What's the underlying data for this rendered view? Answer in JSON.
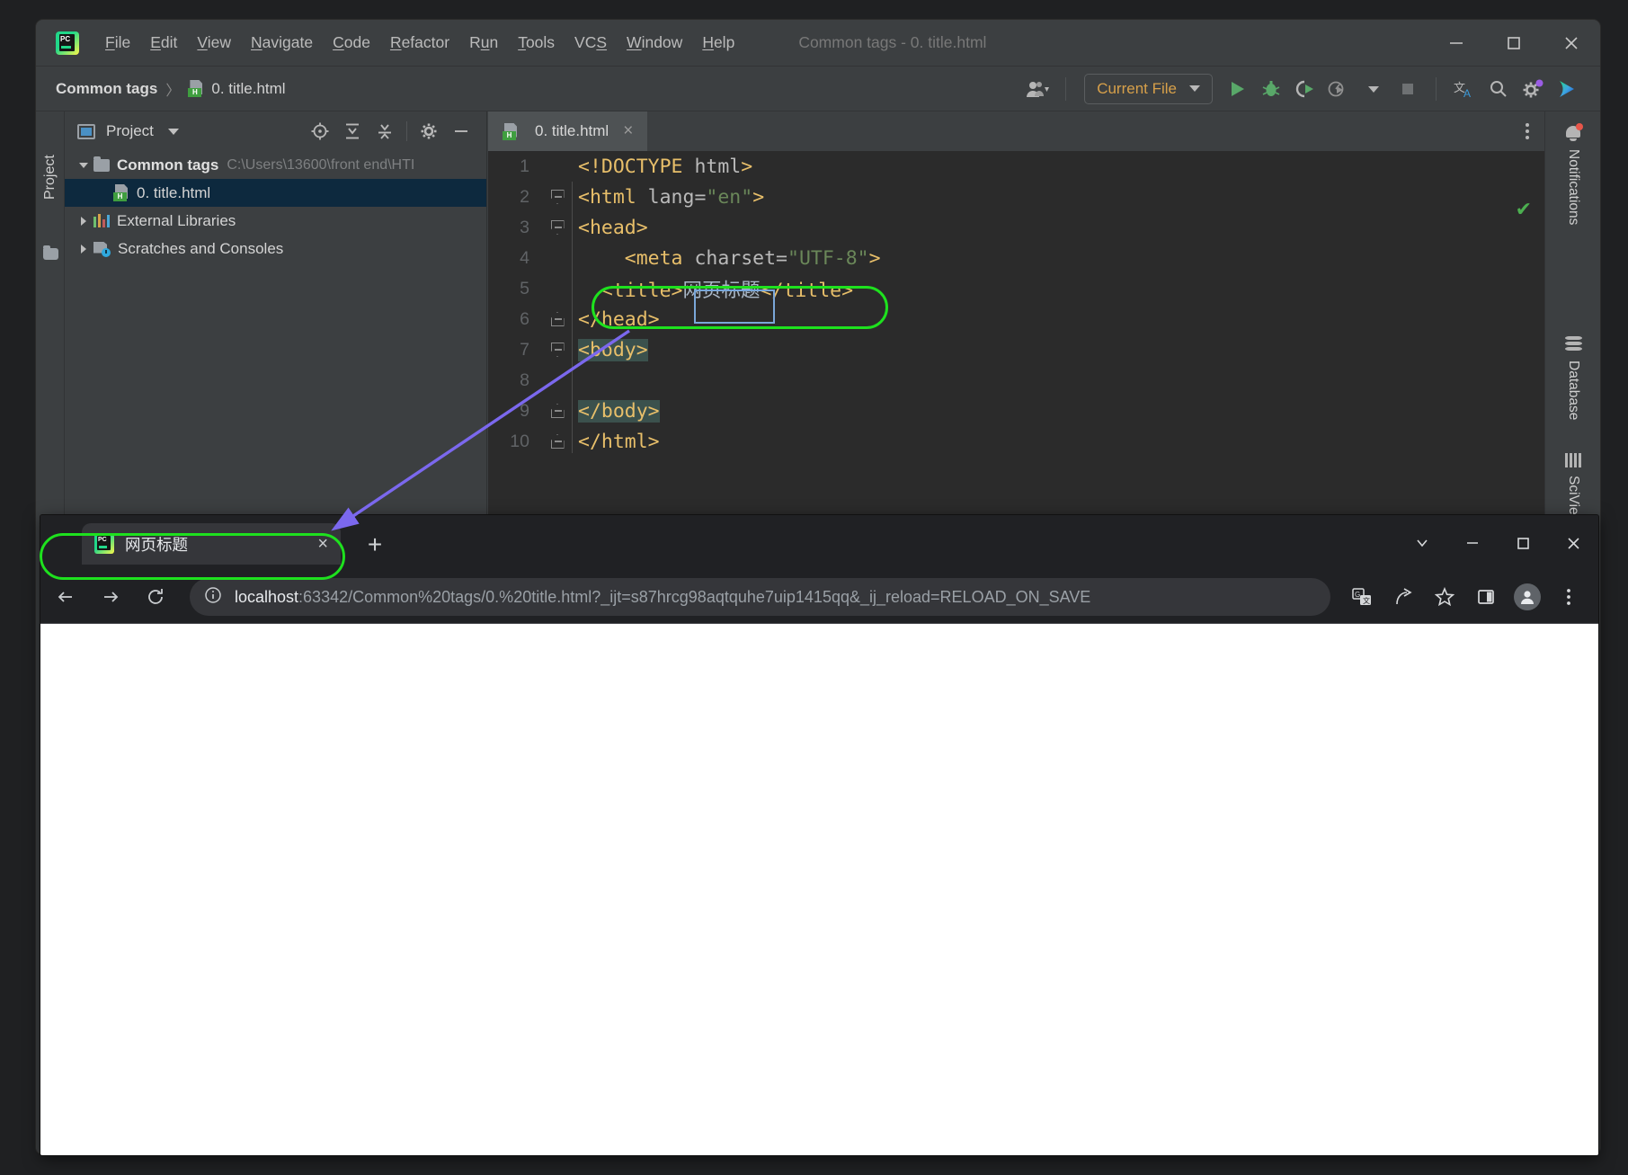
{
  "ide": {
    "logo_icon": "pycharm-logo-icon",
    "menu": [
      {
        "label": "File",
        "mnemonic": "F"
      },
      {
        "label": "Edit",
        "mnemonic": "E"
      },
      {
        "label": "View",
        "mnemonic": "V"
      },
      {
        "label": "Navigate",
        "mnemonic": "N"
      },
      {
        "label": "Code",
        "mnemonic": "C"
      },
      {
        "label": "Refactor",
        "mnemonic": "R"
      },
      {
        "label": "Run",
        "mnemonic": "u"
      },
      {
        "label": "Tools",
        "mnemonic": "T"
      },
      {
        "label": "VCS",
        "mnemonic": "S"
      },
      {
        "label": "Window",
        "mnemonic": "W"
      },
      {
        "label": "Help",
        "mnemonic": "H"
      }
    ],
    "window_title": "Common tags - 0. title.html",
    "window_controls": {
      "minimize": "minimize-icon",
      "maximize": "maximize-icon",
      "close": "close-icon"
    },
    "breadcrumb": {
      "project": "Common tags",
      "separator": "〉",
      "file": "0. title.html"
    },
    "toolbar": {
      "run_config": "Current File",
      "icons": [
        "collaborate-icon",
        "run-icon",
        "debug-icon",
        "run-coverage-icon",
        "profiler-icon",
        "stop-icon",
        "translate-icon",
        "search-everywhere-icon",
        "settings-icon",
        "ide-feature-icon"
      ]
    }
  },
  "project_panel": {
    "title": "Project",
    "tool_icons": [
      "locate-icon",
      "expand-all-icon",
      "collapse-all-icon",
      "settings-icon",
      "hide-icon"
    ],
    "vertical_tab": "Project",
    "tree": [
      {
        "label": "Common tags",
        "path": "C:\\Users\\13600\\front end\\HTI",
        "icon": "folder-icon",
        "expanded": true,
        "selected": false,
        "depth": 0
      },
      {
        "label": "0. title.html",
        "path": "",
        "icon": "html-file-icon",
        "expanded": null,
        "selected": true,
        "depth": 1
      },
      {
        "label": "External Libraries",
        "path": "",
        "icon": "libraries-icon",
        "expanded": false,
        "selected": false,
        "depth": 0
      },
      {
        "label": "Scratches and Consoles",
        "path": "",
        "icon": "scratches-icon",
        "expanded": false,
        "selected": false,
        "depth": 0
      }
    ]
  },
  "editor": {
    "tab": {
      "label": "0. title.html",
      "icon": "html-file-icon",
      "close": "×"
    },
    "options_icon": "more-options-icon",
    "inspection_status": "✔",
    "lines": [
      {
        "n": "1",
        "fold": "",
        "segments": [
          {
            "t": "<!DOCTYPE ",
            "c": "tag"
          },
          {
            "t": "html",
            "c": "attr"
          },
          {
            "t": ">",
            "c": "tag"
          }
        ],
        "indent": ""
      },
      {
        "n": "2",
        "fold": "open",
        "segments": [
          {
            "t": "<html ",
            "c": "tag"
          },
          {
            "t": "lang=",
            "c": "attr"
          },
          {
            "t": "\"en\"",
            "c": "str"
          },
          {
            "t": ">",
            "c": "tag"
          }
        ],
        "indent": ""
      },
      {
        "n": "3",
        "fold": "open",
        "segments": [
          {
            "t": "<head>",
            "c": "tag"
          }
        ],
        "indent": ""
      },
      {
        "n": "4",
        "fold": "",
        "segments": [
          {
            "t": "<meta ",
            "c": "tag"
          },
          {
            "t": "charset=",
            "c": "attr"
          },
          {
            "t": "\"UTF-8\"",
            "c": "str"
          },
          {
            "t": ">",
            "c": "tag"
          }
        ],
        "indent": "    "
      },
      {
        "n": "5",
        "fold": "",
        "segments": [
          {
            "t": "<title>",
            "c": "tag"
          },
          {
            "t": "网页标题",
            "c": "txt"
          },
          {
            "t": "</title>",
            "c": "tag"
          }
        ],
        "indent": "  "
      },
      {
        "n": "6",
        "fold": "close",
        "segments": [
          {
            "t": "</head>",
            "c": "tag"
          }
        ],
        "indent": ""
      },
      {
        "n": "7",
        "fold": "open",
        "segments": [
          {
            "t": "<body>",
            "c": "tag hl-tagpair"
          }
        ],
        "indent": ""
      },
      {
        "n": "8",
        "fold": "",
        "segments": [],
        "indent": ""
      },
      {
        "n": "9",
        "fold": "close",
        "segments": [
          {
            "t": "</body>",
            "c": "tag hl-tagpair"
          }
        ],
        "indent": ""
      },
      {
        "n": "10",
        "fold": "close",
        "segments": [
          {
            "t": "</html>",
            "c": "tag"
          }
        ],
        "indent": ""
      }
    ]
  },
  "right_tool_tabs": [
    {
      "label": "Notifications",
      "icon": "bell-icon",
      "badge": true
    },
    {
      "label": "Database",
      "icon": "database-icon",
      "badge": false
    },
    {
      "label": "SciView",
      "icon": "sciview-icon",
      "badge": false
    }
  ],
  "browser": {
    "tab": {
      "title": "网页标题",
      "favicon": "pycharm-favicon-icon",
      "close": "×"
    },
    "new_tab": "+",
    "window_controls": [
      "tab-search-icon",
      "minimize-icon",
      "maximize-icon",
      "close-icon"
    ],
    "nav": {
      "back": "back-arrow-icon",
      "forward": "forward-arrow-icon",
      "reload": "reload-icon"
    },
    "omnibox": {
      "info_icon": "site-info-icon",
      "host": "localhost",
      "rest": ":63342/Common%20tags/0.%20title.html?_ijt=s87hrcg98aqtquhe7uip1415qq&_ij_reload=RELOAD_ON_SAVE",
      "full_url": "localhost:63342/Common%20tags/0.%20title.html?_ijt=s87hrcg98aqtquhe7uip1415qq&_ij_reload=RELOAD_ON_SAVE"
    },
    "actions": [
      "translate-icon",
      "share-icon",
      "bookmark-star-icon",
      "side-panel-icon",
      "profile-avatar-icon",
      "browser-menu-icon"
    ],
    "page_content": ""
  },
  "annotations": {
    "highlight_color": "#1ee11e",
    "arrow_color": "#7b68ee",
    "selection_box_color": "#7aa7d9",
    "title_line_box": "green rounded rectangle around <title>网页标题</title>",
    "browser_tab_box": "green rounded rectangle around browser tab title",
    "arrow": "purple arrow from title code to browser tab"
  }
}
